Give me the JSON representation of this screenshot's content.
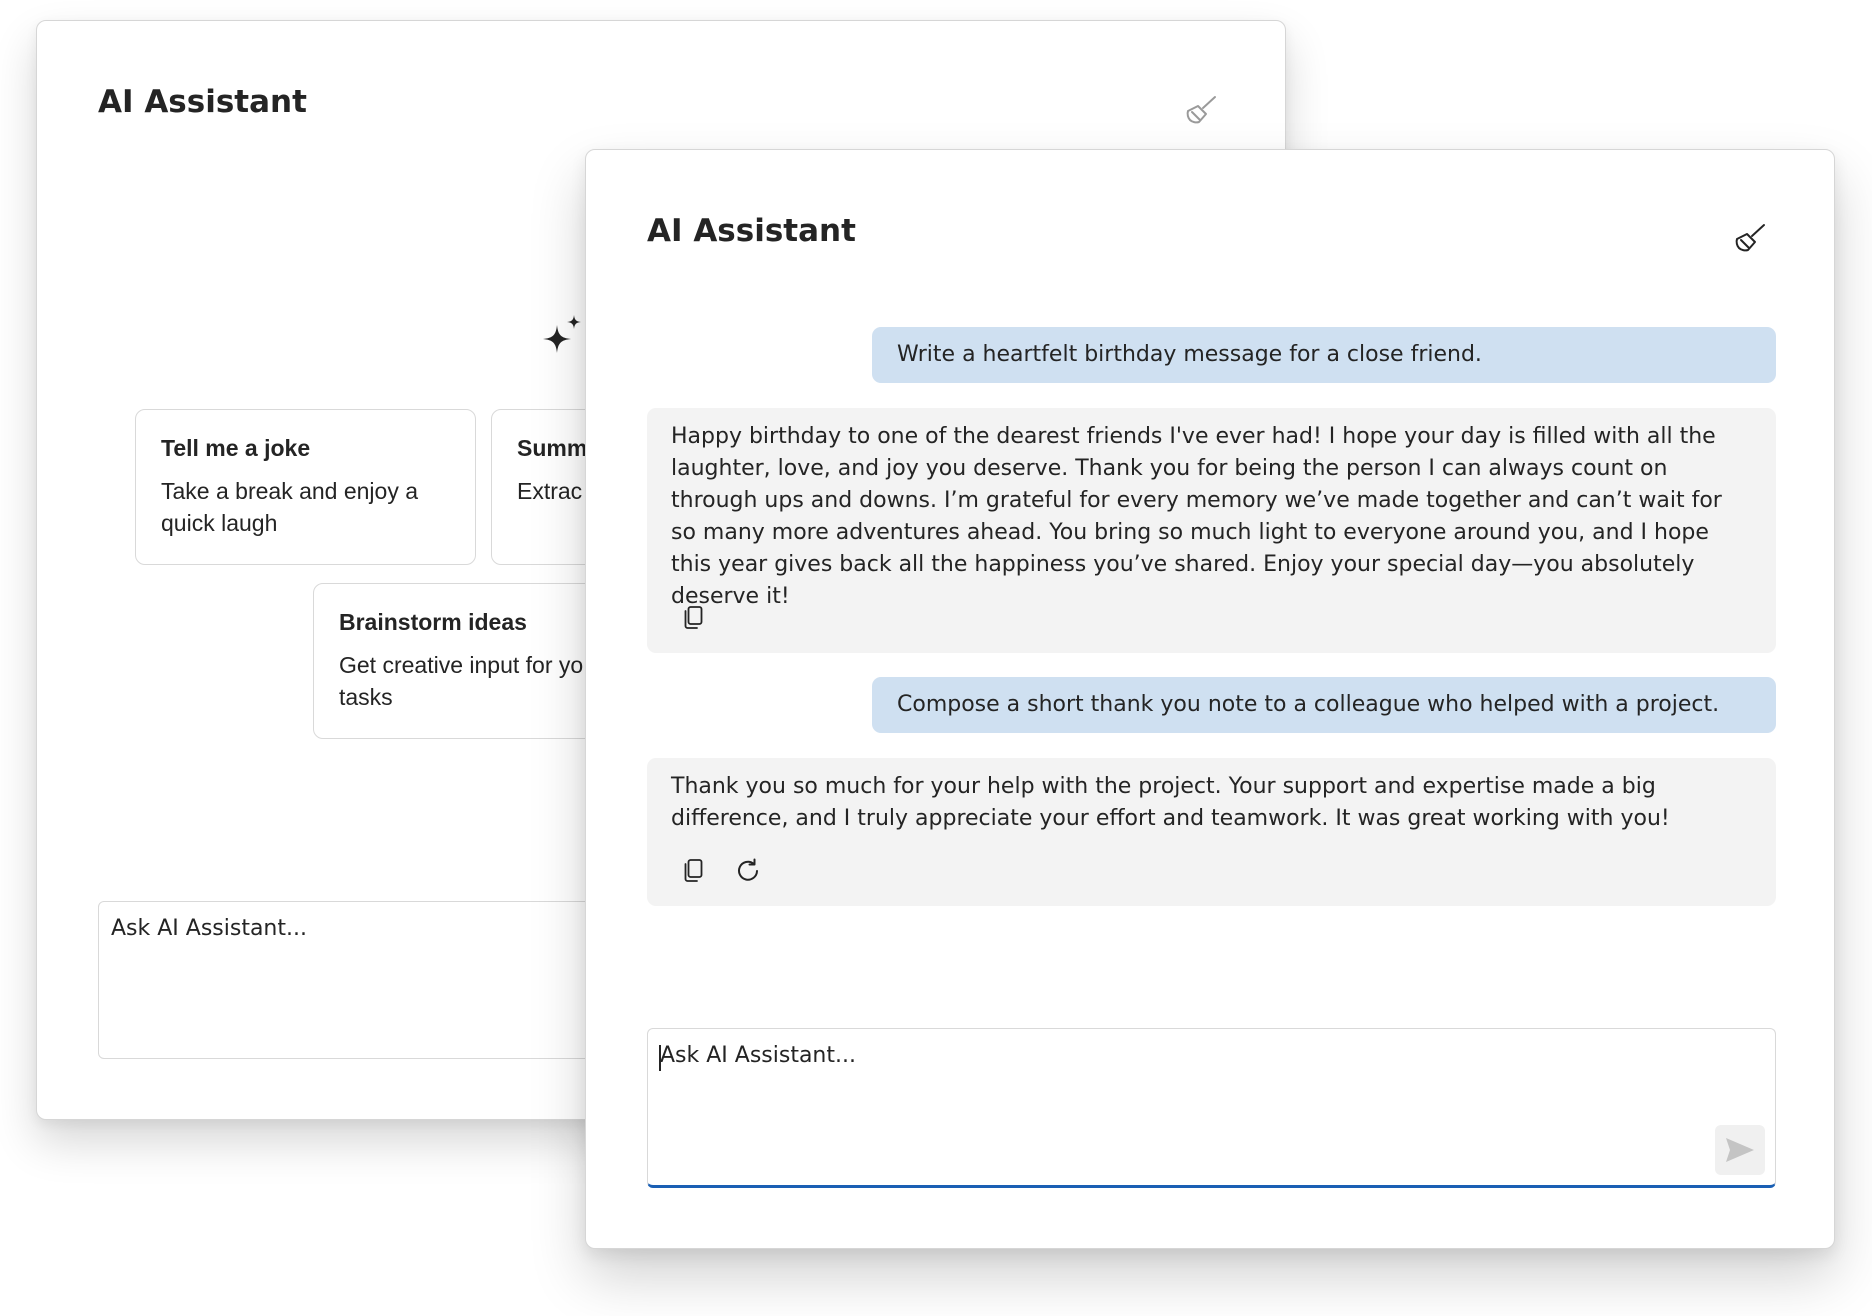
{
  "back_panel": {
    "title": "AI Assistant",
    "suggestions": [
      {
        "title": "Tell me a joke",
        "description": "Take a break and enjoy a quick laugh"
      },
      {
        "title": "Summ",
        "description": "Extrac summa"
      },
      {
        "title": "Brainstorm ideas",
        "description": "Get creative input for yo tasks"
      }
    ],
    "prompt_placeholder": "Ask AI Assistant..."
  },
  "front_panel": {
    "title": "AI Assistant",
    "messages": [
      {
        "role": "user",
        "text": "Write a heartfelt birthday message for a close friend."
      },
      {
        "role": "assistant",
        "text": "Happy birthday to one of the dearest friends I've ever had! I hope your day is filled with all the laughter, love, and joy you deserve. Thank you for being the person I can always count on through ups and downs. I’m grateful for every memory we’ve made together and can’t wait for so many more adventures ahead. You bring so much light to everyone around you, and I hope this year gives back all the happiness you’ve shared. Enjoy your special day—you absolutely deserve it!",
        "actions": [
          "copy-icon"
        ]
      },
      {
        "role": "user",
        "text": "Compose a short thank you note to a colleague who helped with a project."
      },
      {
        "role": "assistant",
        "text": "Thank you so much for your help with the project. Your support and expertise made a big difference, and I truly appreciate your effort and teamwork. It was great working with you!",
        "actions": [
          "copy-icon",
          "regenerate-icon"
        ]
      }
    ],
    "prompt_placeholder": "Ask AI Assistant..."
  },
  "colors": {
    "user_bubble": "#cfe0f1",
    "assistant_bubble": "#f3f3f3",
    "focus_accent": "#1a5fb4"
  }
}
